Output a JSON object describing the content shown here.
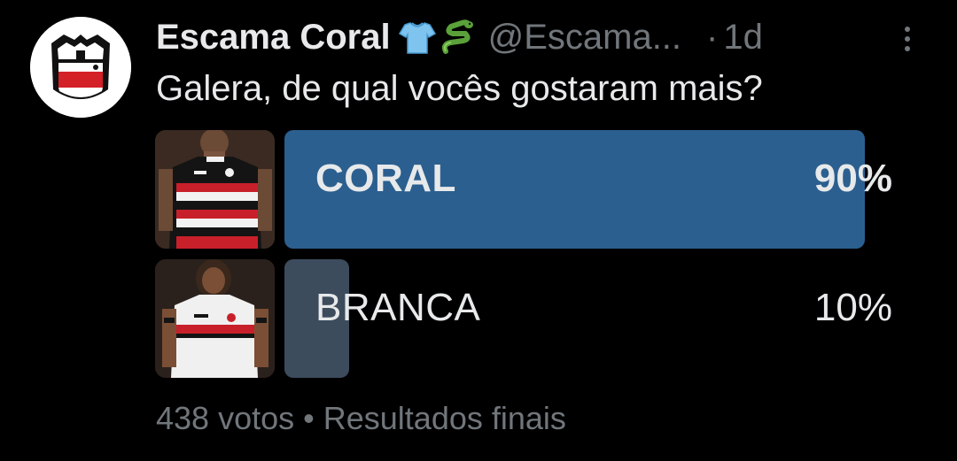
{
  "tweet": {
    "author": {
      "display_name": "Escama Coral",
      "badge_emojis": [
        "tshirt-emoji",
        "snake-emoji"
      ],
      "handle": "@Escama...",
      "separator": "·",
      "time": "1d"
    },
    "text": "Galera, de qual vocês gostaram mais?",
    "poll": {
      "options": [
        {
          "label": "CORAL",
          "percent_label": "90%",
          "percent": 90,
          "winner": true,
          "bar_color": "#2b5f8f"
        },
        {
          "label": "BRANCA",
          "percent_label": "10%",
          "percent": 10,
          "winner": false,
          "bar_color": "#3c4c5d"
        }
      ],
      "votes": "438 votos",
      "footer_separator": "•",
      "status": "Resultados finais"
    }
  },
  "colors": {
    "background": "#000000",
    "primary_text": "#e7e9ea",
    "secondary_text": "#71767b",
    "winner_bar": "#2b5f8f",
    "loser_bar": "#3c4c5d"
  },
  "icons": {
    "more": "more-vertical-icon",
    "avatar": "club-crest-avatar"
  }
}
